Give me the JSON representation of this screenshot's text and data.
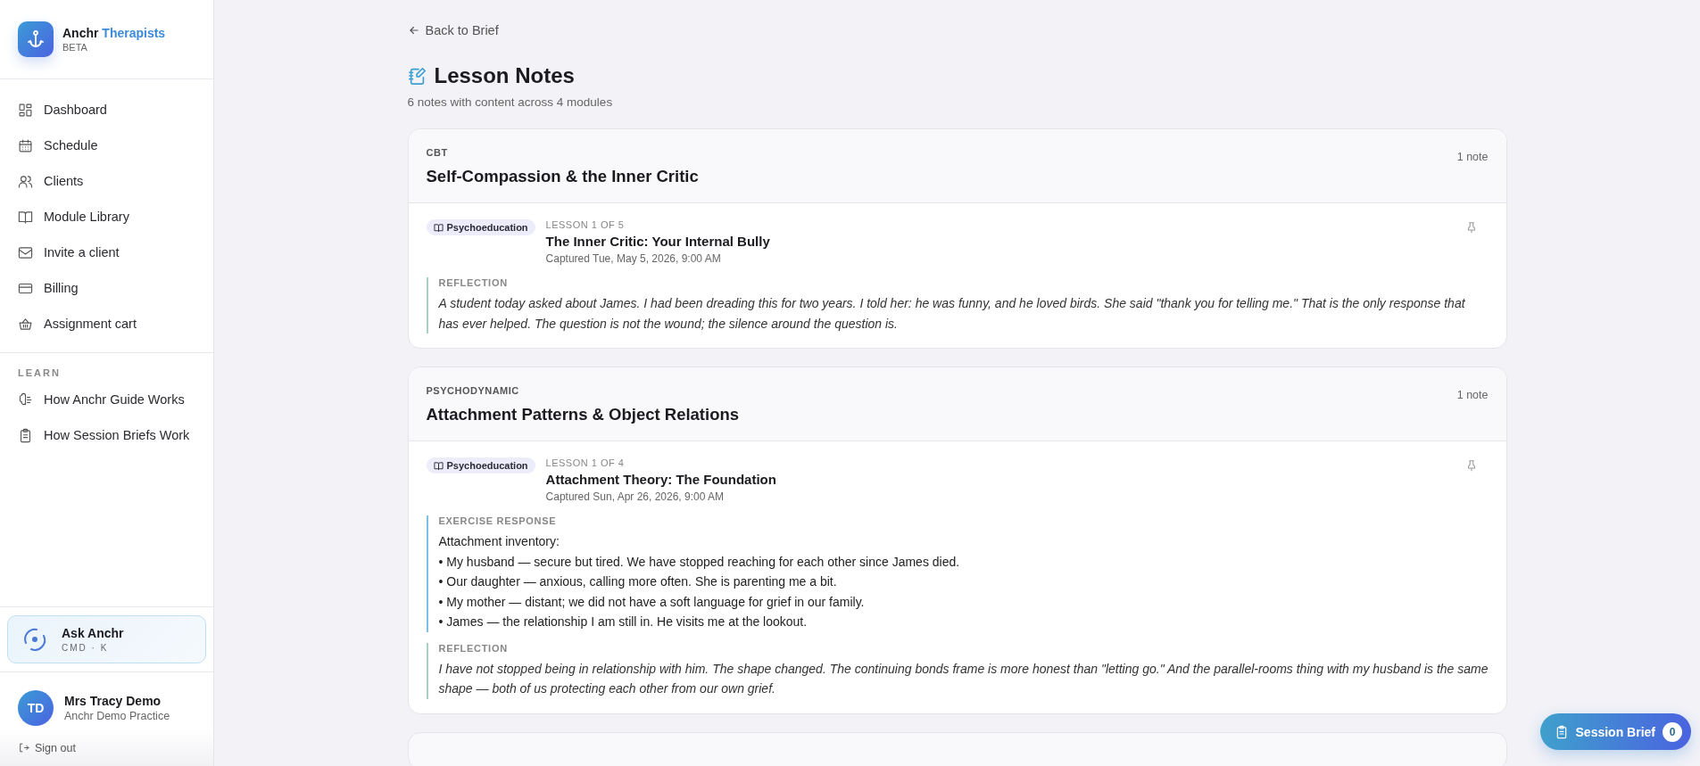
{
  "brand": {
    "name": "Anchr",
    "accent": "Therapists",
    "badge": "BETA"
  },
  "nav": [
    {
      "label": "Dashboard"
    },
    {
      "label": "Schedule"
    },
    {
      "label": "Clients"
    },
    {
      "label": "Module Library"
    },
    {
      "label": "Invite a client"
    },
    {
      "label": "Billing"
    },
    {
      "label": "Assignment cart"
    }
  ],
  "learn": {
    "heading": "LEARN",
    "items": [
      {
        "label": "How Anchr Guide Works"
      },
      {
        "label": "How Session Briefs Work"
      }
    ]
  },
  "ask": {
    "title": "Ask Anchr",
    "shortcut": "CMD · K"
  },
  "user": {
    "initials": "TD",
    "name": "Mrs Tracy Demo",
    "practice": "Anchr Demo Practice"
  },
  "sign_out": "Sign out",
  "back_link": "Back to Brief",
  "page": {
    "title": "Lesson Notes",
    "subtitle": "6 notes with content across 4 modules"
  },
  "modules": [
    {
      "category": "CBT",
      "title": "Self-Compassion & the Inner Critic",
      "count": "1 note",
      "notes": [
        {
          "tag": "Psychoeducation",
          "lesson": "LESSON 1 OF 5",
          "title": "The Inner Critic: Your Internal Bully",
          "captured": "Captured Tue, May 5, 2026, 9:00 AM",
          "sections": [
            {
              "kind": "reflection",
              "label": "REFLECTION",
              "text": "A student today asked about James. I had been dreading this for two years. I told her: he was funny, and he loved birds. She said \"thank you for telling me.\" That is the only response that has ever helped. The question is not the wound; the silence around the question is."
            }
          ]
        }
      ]
    },
    {
      "category": "PSYCHODYNAMIC",
      "title": "Attachment Patterns & Object Relations",
      "count": "1 note",
      "notes": [
        {
          "tag": "Psychoeducation",
          "lesson": "LESSON 1 OF 4",
          "title": "Attachment Theory: The Foundation",
          "captured": "Captured Sun, Apr 26, 2026, 9:00 AM",
          "sections": [
            {
              "kind": "exercise",
              "label": "EXERCISE RESPONSE",
              "lines": [
                "Attachment inventory:",
                "• My husband — secure but tired. We have stopped reaching for each other since James died.",
                "• Our daughter — anxious, calling more often. She is parenting me a bit.",
                "• My mother — distant; we did not have a soft language for grief in our family.",
                "• James — the relationship I am still in. He visits me at the lookout."
              ]
            },
            {
              "kind": "reflection",
              "label": "REFLECTION",
              "text": "I have not stopped being in relationship with him. The shape changed. The continuing bonds frame is more honest than \"letting go.\" And the parallel-rooms thing with my husband is the same shape — both of us protecting each other from our own grief."
            }
          ]
        }
      ]
    }
  ],
  "session_brief": {
    "label": "Session Brief",
    "count": "0"
  }
}
